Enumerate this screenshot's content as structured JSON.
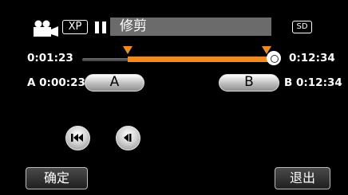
{
  "header": {
    "mode_badge": "XP",
    "title": "修剪",
    "storage_badge": "SD"
  },
  "timeline": {
    "current_time": "0:01:23",
    "total_time": "0:12:34",
    "progress": 1.0,
    "a_position": 0.22,
    "b_position": 0.98
  },
  "points": {
    "a_label": "A",
    "a_time": "0:00:23",
    "b_label": "B",
    "b_time": "0:12:34",
    "a_button": "A",
    "b_button": "B"
  },
  "buttons": {
    "confirm": "确定",
    "exit": "退出"
  },
  "icons": {
    "camera": "video-camera-icon",
    "pause": "pause-icon",
    "prev": "skip-to-start-icon",
    "frame_back": "frame-back-icon"
  },
  "colors": {
    "accent": "#f28a20",
    "background": "#000000",
    "title_bar": "#6b6b6b"
  }
}
